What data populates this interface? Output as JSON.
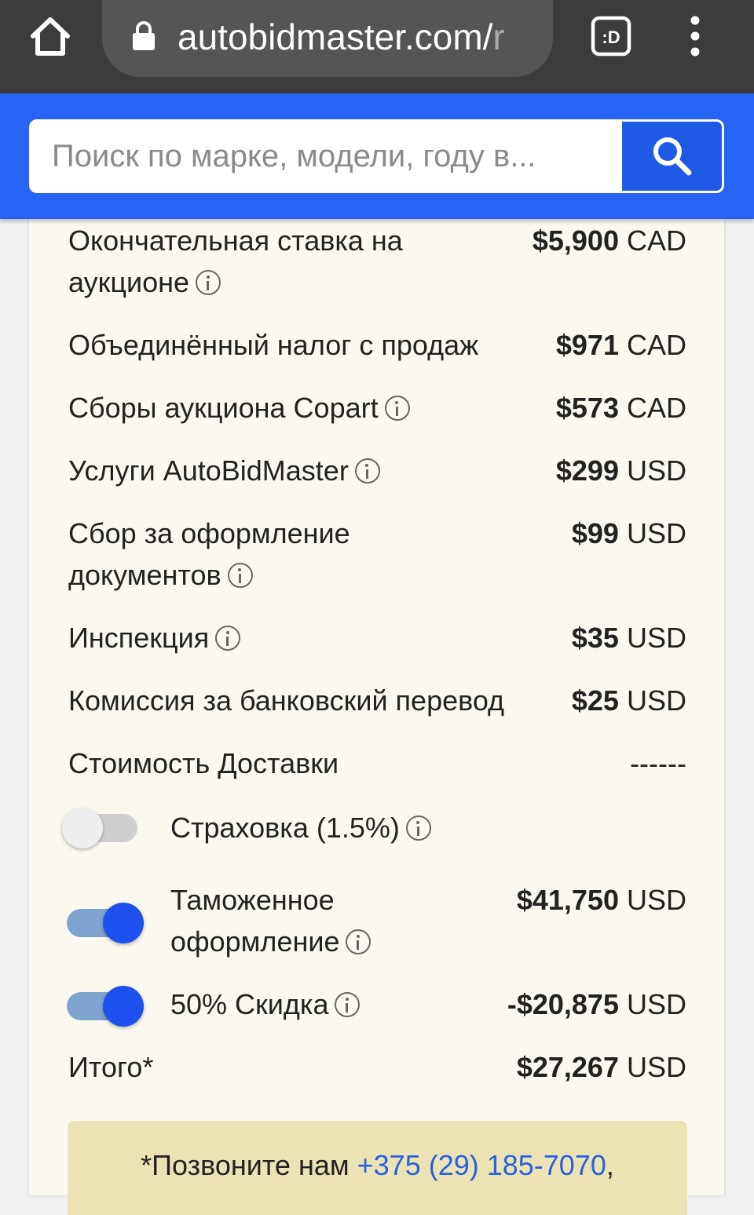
{
  "browser": {
    "url_main": "autobidmaster.com/",
    "url_faded": "r",
    "tabs_icon_label": ":D"
  },
  "search": {
    "placeholder": "Поиск по марке, модели, году в..."
  },
  "rows": [
    {
      "label": "Окончательная ставка на аукционе",
      "amount": "$5,900",
      "currency": "CAD",
      "info": true
    },
    {
      "label": "Объединённый налог с продаж",
      "amount": "$971",
      "currency": "CAD",
      "info": false
    },
    {
      "label": "Сборы аукциона Copart",
      "amount": "$573",
      "currency": "CAD",
      "info": true
    },
    {
      "label": "Услуги AutoBidMaster",
      "amount": "$299",
      "currency": "USD",
      "info": true
    },
    {
      "label": "Сбор за оформление документов",
      "amount": "$99",
      "currency": "USD",
      "info": true
    },
    {
      "label": "Инспекция",
      "amount": "$35",
      "currency": "USD",
      "info": true
    },
    {
      "label": "Комиссия за банковский перевод",
      "amount": "$25",
      "currency": "USD",
      "info": false
    },
    {
      "label": "Стоимость Доставки",
      "amount": "------",
      "currency": "",
      "info": false
    }
  ],
  "toggles": [
    {
      "label": "Страховка (1.5%)",
      "on": false,
      "amount": "",
      "currency": ""
    },
    {
      "label": "Таможенное оформление",
      "on": true,
      "amount": "$41,750",
      "currency": "USD"
    },
    {
      "label": "50% Скидка",
      "on": true,
      "amount": "-$20,875",
      "currency": "USD"
    }
  ],
  "total": {
    "label": "Итого*",
    "amount": "$27,267",
    "currency": "USD"
  },
  "note": {
    "prefix": "*Позвоните нам ",
    "phone": "+375 (29) 185-7070",
    "suffix": ","
  },
  "colors": {
    "header_blue": "#2864f4",
    "toggle_on": "#1e50ee",
    "card_bg": "#fbf9ef",
    "note_bg": "#ece3b4",
    "link": "#2a5fe0"
  }
}
